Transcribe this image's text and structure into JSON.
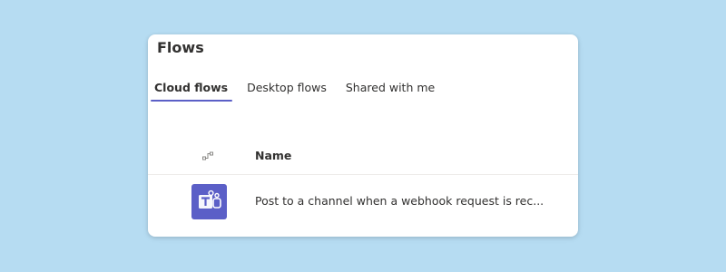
{
  "page": {
    "title": "Flows"
  },
  "tabs": [
    {
      "label": "Cloud flows",
      "active": true
    },
    {
      "label": "Desktop flows",
      "active": false
    },
    {
      "label": "Shared with me",
      "active": false
    }
  ],
  "table": {
    "columns": [
      "Name"
    ],
    "rows": [
      {
        "icon": "teams-icon",
        "name": "Post to a channel when a webhook request is rec..."
      }
    ]
  },
  "colors": {
    "background": "#b6dcf2",
    "accent": "#5b5fc7",
    "text": "#323130"
  },
  "icons": {
    "header": "flow-type-icon",
    "row": "teams-icon"
  }
}
